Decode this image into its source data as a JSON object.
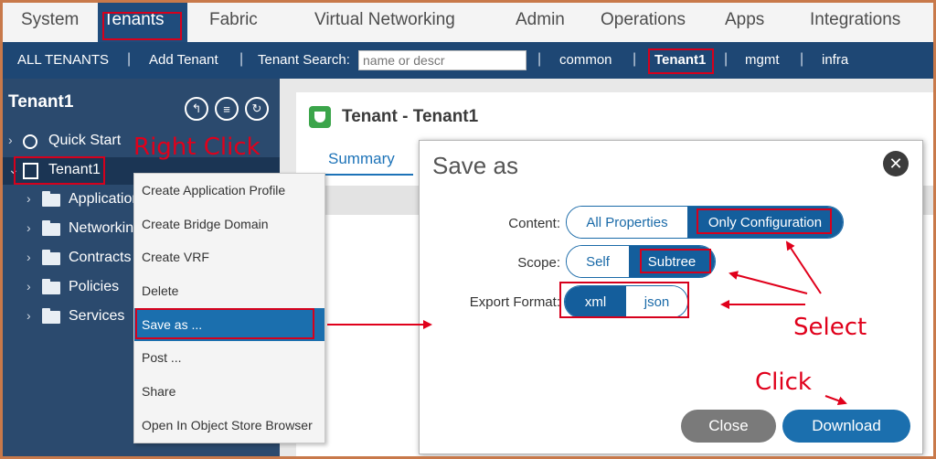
{
  "topnav": {
    "tabs": [
      "System",
      "Tenants",
      "Fabric",
      "Virtual Networking",
      "Admin",
      "Operations",
      "Apps",
      "Integrations"
    ]
  },
  "subnav": {
    "all_tenants": "ALL TENANTS",
    "add_tenant": "Add Tenant",
    "search_label": "Tenant Search:",
    "search_placeholder": "name or descr",
    "links": [
      "common",
      "Tenant1",
      "mgmt",
      "infra"
    ]
  },
  "sidebar": {
    "title": "Tenant1",
    "items": [
      {
        "label": "Quick Start"
      },
      {
        "label": "Tenant1"
      },
      {
        "label": "Application"
      },
      {
        "label": "Networking"
      },
      {
        "label": "Contracts"
      },
      {
        "label": "Policies"
      },
      {
        "label": "Services"
      }
    ]
  },
  "main": {
    "title": "Tenant - Tenant1",
    "tab_summary": "Summary"
  },
  "context_menu": {
    "items": [
      "Create Application Profile",
      "Create Bridge Domain",
      "Create VRF",
      "Delete",
      "Save as ...",
      "Post ...",
      "Share",
      "Open In Object Store Browser"
    ]
  },
  "dialog": {
    "title": "Save as",
    "content_label": "Content:",
    "content_options": [
      "All Properties",
      "Only Configuration"
    ],
    "scope_label": "Scope:",
    "scope_options": [
      "Self",
      "Subtree"
    ],
    "format_label": "Export Format:",
    "format_options": [
      "xml",
      "json"
    ],
    "close_button": "Close",
    "download_button": "Download"
  },
  "annotations": {
    "right_click": "Right Click",
    "select": "Select",
    "click": "Click"
  },
  "colors": {
    "nav_blue": "#1e4774",
    "sidebar": "#2b4a6e",
    "accent": "#1b6fae",
    "annotation_red": "#d6001c"
  }
}
